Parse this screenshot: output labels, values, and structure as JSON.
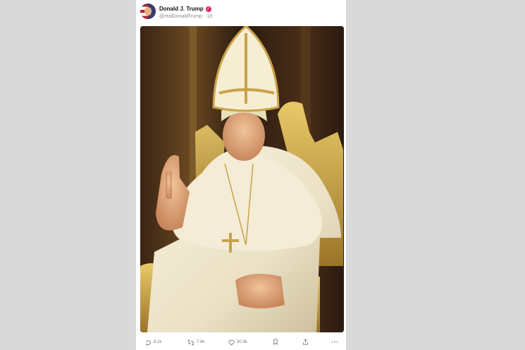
{
  "post": {
    "author_name": "Donald J. Trump",
    "handle": "@realDonaldTrump",
    "separator": "·",
    "timestamp": "1d",
    "avatar_icon": "user-avatar",
    "verified_icon": "verified-badge-icon",
    "accent": "#e0245e",
    "image_subject": "man seated on a golden throne in white papal vestments and mitre, raising an index finger"
  },
  "actions": {
    "replies": "6.1k",
    "reposts": "7.8k",
    "likes": "30.9k",
    "icons": [
      "reply-icon",
      "repost-icon",
      "like-icon",
      "bookmark-icon",
      "share-icon",
      "more-icon"
    ]
  }
}
